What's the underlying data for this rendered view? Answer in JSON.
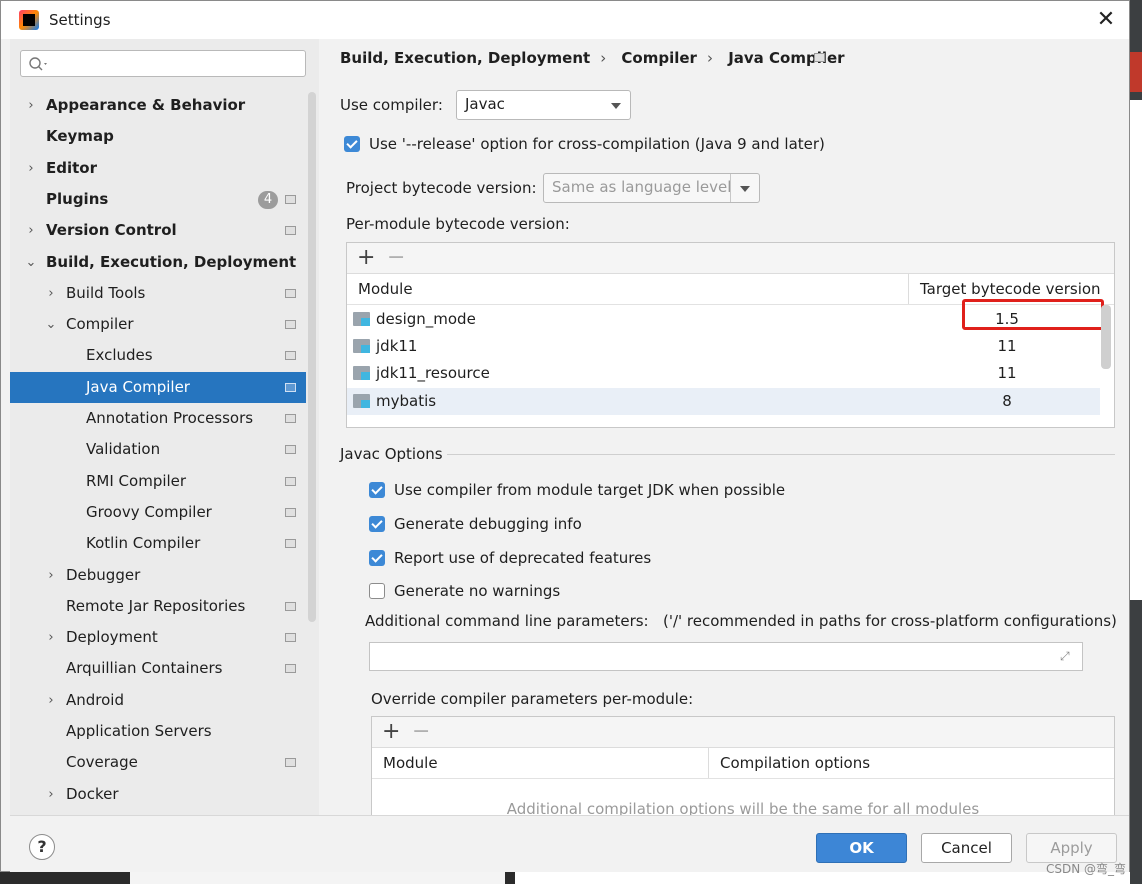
{
  "window": {
    "title": "Settings"
  },
  "sidebar": {
    "search_placeholder": "",
    "items": [
      {
        "label": "Appearance & Behavior",
        "arrow": "›",
        "bold": true,
        "indent": 0
      },
      {
        "label": "Keymap",
        "arrow": "",
        "bold": true,
        "indent": 0
      },
      {
        "label": "Editor",
        "arrow": "›",
        "bold": true,
        "indent": 0
      },
      {
        "label": "Plugins",
        "arrow": "",
        "bold": true,
        "indent": 0,
        "badge": "4",
        "page": true
      },
      {
        "label": "Version Control",
        "arrow": "›",
        "bold": true,
        "indent": 0,
        "page": true
      },
      {
        "label": "Build, Execution, Deployment",
        "arrow": "⌄",
        "bold": true,
        "indent": 0
      },
      {
        "label": "Build Tools",
        "arrow": "›",
        "indent": 1,
        "page": true
      },
      {
        "label": "Compiler",
        "arrow": "⌄",
        "indent": 1,
        "page": true
      },
      {
        "label": "Excludes",
        "arrow": "",
        "indent": 2,
        "page": true
      },
      {
        "label": "Java Compiler",
        "arrow": "",
        "indent": 2,
        "page": true,
        "selected": true
      },
      {
        "label": "Annotation Processors",
        "arrow": "",
        "indent": 2,
        "page": true
      },
      {
        "label": "Validation",
        "arrow": "",
        "indent": 2,
        "page": true
      },
      {
        "label": "RMI Compiler",
        "arrow": "",
        "indent": 2,
        "page": true
      },
      {
        "label": "Groovy Compiler",
        "arrow": "",
        "indent": 2,
        "page": true
      },
      {
        "label": "Kotlin Compiler",
        "arrow": "",
        "indent": 2,
        "page": true
      },
      {
        "label": "Debugger",
        "arrow": "›",
        "indent": 1
      },
      {
        "label": "Remote Jar Repositories",
        "arrow": "",
        "indent": 1,
        "page": true
      },
      {
        "label": "Deployment",
        "arrow": "›",
        "indent": 1,
        "page": true
      },
      {
        "label": "Arquillian Containers",
        "arrow": "",
        "indent": 1,
        "page": true
      },
      {
        "label": "Android",
        "arrow": "›",
        "indent": 1
      },
      {
        "label": "Application Servers",
        "arrow": "",
        "indent": 1
      },
      {
        "label": "Coverage",
        "arrow": "",
        "indent": 1,
        "page": true
      },
      {
        "label": "Docker",
        "arrow": "›",
        "indent": 1
      }
    ]
  },
  "breadcrumb": [
    "Build, Execution, Deployment",
    "Compiler",
    "Java Compiler"
  ],
  "compiler": {
    "use_compiler_label": "Use compiler:",
    "use_compiler_value": "Javac",
    "release_option_label": "Use '--release' option for cross-compilation (Java 9 and later)",
    "project_bytecode_label": "Project bytecode version:",
    "project_bytecode_value": "Same as language level",
    "per_module_label": "Per-module bytecode version:"
  },
  "module_table": {
    "add": "+",
    "remove": "−",
    "col_module": "Module",
    "col_target": "Target bytecode version",
    "rows": [
      {
        "module": "design_mode",
        "version": "1.5"
      },
      {
        "module": "jdk11",
        "version": "11"
      },
      {
        "module": "jdk11_resource",
        "version": "11"
      },
      {
        "module": "mybatis",
        "version": "8"
      }
    ]
  },
  "javac": {
    "section_title": "Javac Options",
    "opt1": "Use compiler from module target JDK when possible",
    "opt2": "Generate debugging info",
    "opt3": "Report use of deprecated features",
    "opt4": "Generate no warnings",
    "cmd_label": "Additional command line parameters:",
    "cmd_hint": "('/' recommended in paths for cross-platform configurations)",
    "override_label": "Override compiler parameters per-module:"
  },
  "override_table": {
    "add": "+",
    "remove": "−",
    "col_module": "Module",
    "col_options": "Compilation options",
    "empty": "Additional compilation options will be the same for all modules"
  },
  "footer": {
    "help": "?",
    "ok": "OK",
    "cancel": "Cancel",
    "apply": "Apply"
  },
  "watermark": "CSDN @弯_弯",
  "colors": {
    "selection": "#2675bf",
    "ok_button": "#3d86d6",
    "highlight_box": "#e0201b"
  }
}
